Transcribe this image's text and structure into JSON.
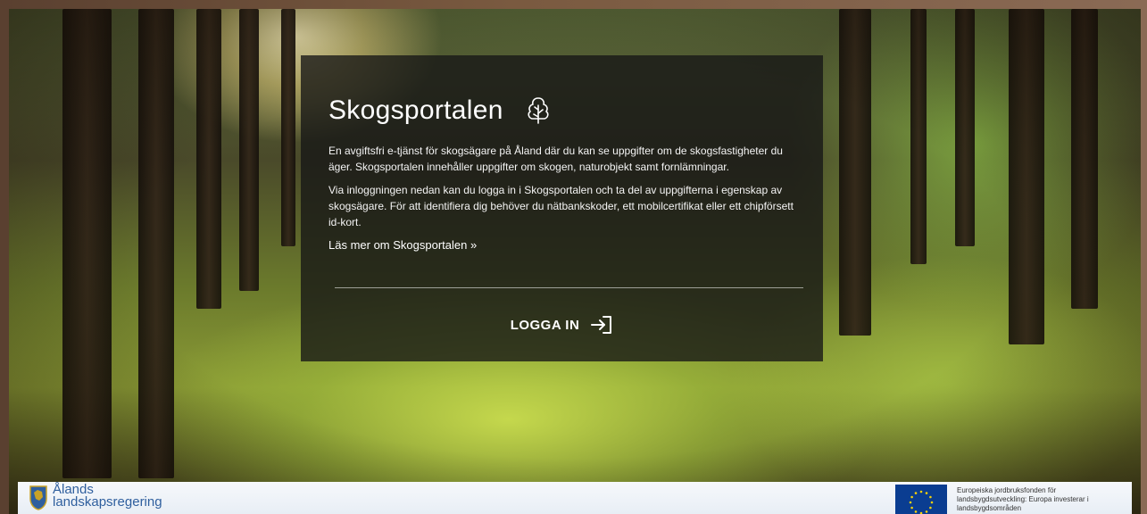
{
  "card": {
    "title": "Skogsportalen",
    "intro": "En avgiftsfri e-tjänst för skogsägare på Åland där du kan se uppgifter om de skogsfastigheter du äger. Skogsportalen innehåller uppgifter om skogen, naturobjekt samt fornlämningar.",
    "login_info": "Via inloggningen nedan kan du logga in i Skogsportalen och ta del av uppgifterna i egenskap av skogsägare. För att identifiera dig behöver du nätbankskoder, ett mobilcertifikat eller ett chipförsett id-kort.",
    "read_more_link": "Läs mer om Skogsportalen »",
    "login_button": "LOGGA IN",
    "title_icon": "tree-icon",
    "login_icon": "login-arrow-icon"
  },
  "footer": {
    "logo_line1": "Ålands",
    "logo_line2": "landskapsregering",
    "logo_icon": "crest-icon",
    "eu_icon": "eu-flag-icon",
    "eu_text": "Europeiska jordbruksfonden för landsbygdsutveckling: Europa investerar i landsbygdsområden"
  },
  "colors": {
    "card_background": "#161616",
    "logo_blue": "#2f5f9e",
    "eu_blue": "#0a3d91",
    "eu_star": "#f5d20a"
  }
}
